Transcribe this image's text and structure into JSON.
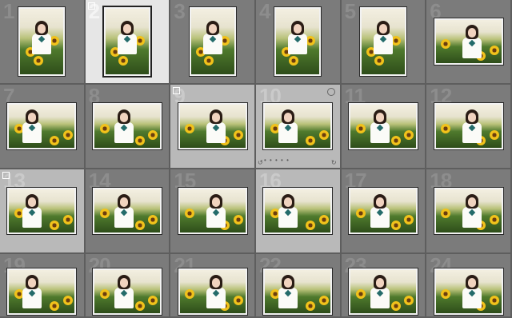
{
  "library_grid": {
    "cells": [
      {
        "index": "1",
        "orientation": "portrait",
        "state": "normal"
      },
      {
        "index": "2",
        "orientation": "portrait",
        "state": "primary",
        "flag": true
      },
      {
        "index": "3",
        "orientation": "portrait",
        "state": "normal"
      },
      {
        "index": "4",
        "orientation": "portrait",
        "state": "normal"
      },
      {
        "index": "5",
        "orientation": "portrait",
        "state": "normal"
      },
      {
        "index": "6",
        "orientation": "landscape",
        "state": "normal"
      },
      {
        "index": "7",
        "orientation": "landscape",
        "state": "normal"
      },
      {
        "index": "8",
        "orientation": "landscape",
        "state": "normal"
      },
      {
        "index": "9",
        "orientation": "landscape",
        "state": "selected",
        "flag": true
      },
      {
        "index": "10",
        "orientation": "landscape",
        "state": "selected",
        "hover": true,
        "dots": "• • • • •"
      },
      {
        "index": "11",
        "orientation": "landscape",
        "state": "normal"
      },
      {
        "index": "12",
        "orientation": "landscape",
        "state": "normal"
      },
      {
        "index": "13",
        "orientation": "landscape",
        "state": "selected",
        "flag": true
      },
      {
        "index": "14",
        "orientation": "landscape",
        "state": "normal"
      },
      {
        "index": "15",
        "orientation": "landscape",
        "state": "normal"
      },
      {
        "index": "16",
        "orientation": "landscape",
        "state": "selected"
      },
      {
        "index": "17",
        "orientation": "landscape",
        "state": "normal"
      },
      {
        "index": "18",
        "orientation": "landscape",
        "state": "normal"
      },
      {
        "index": "19",
        "orientation": "landscape",
        "state": "normal"
      },
      {
        "index": "20",
        "orientation": "landscape",
        "state": "normal"
      },
      {
        "index": "21",
        "orientation": "landscape",
        "state": "normal"
      },
      {
        "index": "22",
        "orientation": "landscape",
        "state": "normal"
      },
      {
        "index": "23",
        "orientation": "landscape",
        "state": "normal"
      },
      {
        "index": "24",
        "orientation": "landscape",
        "state": "normal"
      }
    ]
  },
  "colors": {
    "cell_normal": "#7b7b7b",
    "cell_selected": "#b9b9b9",
    "cell_primary": "#e6e6e6",
    "background": "#5a5a5a"
  }
}
